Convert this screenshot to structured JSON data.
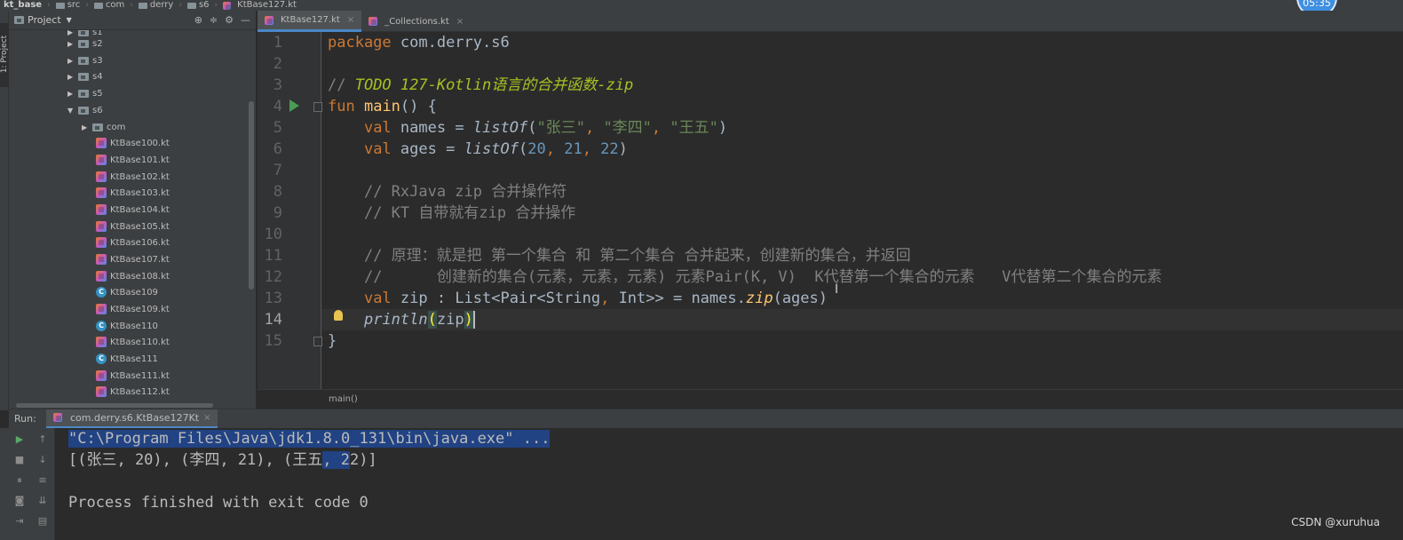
{
  "breadcrumb": [
    "kt_base",
    "src",
    "com",
    "derry",
    "s6",
    "KtBase127.kt"
  ],
  "timer": "05:35",
  "tool_strip": {
    "project_tab": "1: Project"
  },
  "project_panel": {
    "title": "Project",
    "tree": [
      {
        "label": "s2",
        "kind": "folder",
        "expanded": false
      },
      {
        "label": "s3",
        "kind": "folder",
        "expanded": false
      },
      {
        "label": "s4",
        "kind": "folder",
        "expanded": false
      },
      {
        "label": "s5",
        "kind": "folder",
        "expanded": false
      },
      {
        "label": "s6",
        "kind": "folder",
        "expanded": true
      },
      {
        "label": "com",
        "kind": "folder",
        "expanded": false
      },
      {
        "label": "KtBase100.kt",
        "kind": "kt"
      },
      {
        "label": "KtBase101.kt",
        "kind": "kt"
      },
      {
        "label": "KtBase102.kt",
        "kind": "kt"
      },
      {
        "label": "KtBase103.kt",
        "kind": "kt"
      },
      {
        "label": "KtBase104.kt",
        "kind": "kt"
      },
      {
        "label": "KtBase105.kt",
        "kind": "kt"
      },
      {
        "label": "KtBase106.kt",
        "kind": "kt"
      },
      {
        "label": "KtBase107.kt",
        "kind": "kt"
      },
      {
        "label": "KtBase108.kt",
        "kind": "kt"
      },
      {
        "label": "KtBase109",
        "kind": "class"
      },
      {
        "label": "KtBase109.kt",
        "kind": "kt"
      },
      {
        "label": "KtBase110",
        "kind": "class"
      },
      {
        "label": "KtBase110.kt",
        "kind": "kt"
      },
      {
        "label": "KtBase111",
        "kind": "class"
      },
      {
        "label": "KtBase111.kt",
        "kind": "kt"
      },
      {
        "label": "KtBase112.kt",
        "kind": "kt"
      }
    ]
  },
  "editor_tabs": [
    {
      "label": "KtBase127.kt",
      "active": true
    },
    {
      "label": "_Collections.kt",
      "active": false
    }
  ],
  "editor": {
    "line_numbers": [
      "1",
      "2",
      "3",
      "4",
      "5",
      "6",
      "7",
      "8",
      "9",
      "10",
      "11",
      "12",
      "13",
      "14",
      "15"
    ],
    "current_line": "14",
    "code": {
      "l1_kw": "package",
      "l1_rest": " com.derry.s6",
      "l3_prefix": "// ",
      "l3_todo": "TODO 127-Kotlin语言的合并函数-zip",
      "l4_kw": "fun",
      "l4_fn": "main",
      "l4_rest": "() {",
      "l5_indent": "    ",
      "l5_kw": "val",
      "l5_name": " names = ",
      "l5_fn": "listOf",
      "l5_open": "(",
      "l5_s1": "\"张三\"",
      "l5_c1": ", ",
      "l5_s2": "\"李四\"",
      "l5_c2": ", ",
      "l5_s3": "\"王五\"",
      "l5_close": ")",
      "l6_kw": "val",
      "l6_name": " ages = ",
      "l6_fn": "listOf",
      "l6_open": "(",
      "l6_n1": "20",
      "l6_c1": ", ",
      "l6_n2": "21",
      "l6_c2": ", ",
      "l6_n3": "22",
      "l6_close": ")",
      "l8": "// RxJava zip 合并操作符",
      "l9": "// KT 自带就有zip 合并操作",
      "l11": "// 原理：就是把 第一个集合 和 第二个集合 合并起来，创建新的集合，并返回",
      "l12": "//      创建新的集合(元素，元素，元素) 元素Pair(K, V)  K代替第一个集合的元素   V代替第二个集合的元素",
      "l13_kw": "val",
      "l13_a": " zip : List<Pair<String",
      "l13_comma": ",",
      "l13_b": " Int>> = names.",
      "l13_fn": "zip",
      "l13_c": "(ages)",
      "l14_fn": "println",
      "l14_open": "(",
      "l14_arg": "zip",
      "l14_close": ")",
      "l15": "}"
    },
    "footer_breadcrumb": "main()"
  },
  "run_panel": {
    "label": "Run:",
    "tab_label": "com.derry.s6.KtBase127Kt",
    "console": {
      "cmd": "\"C:\\Program Files\\Java\\jdk1.8.0_131\\bin\\java.exe\" ...",
      "output_a": "[(张三, 20), (李四, 21), (王五",
      "output_sel": ", 2",
      "output_b": "2)]",
      "exit": "Process finished with exit code 0"
    }
  },
  "watermark": "CSDN @xuruhua"
}
